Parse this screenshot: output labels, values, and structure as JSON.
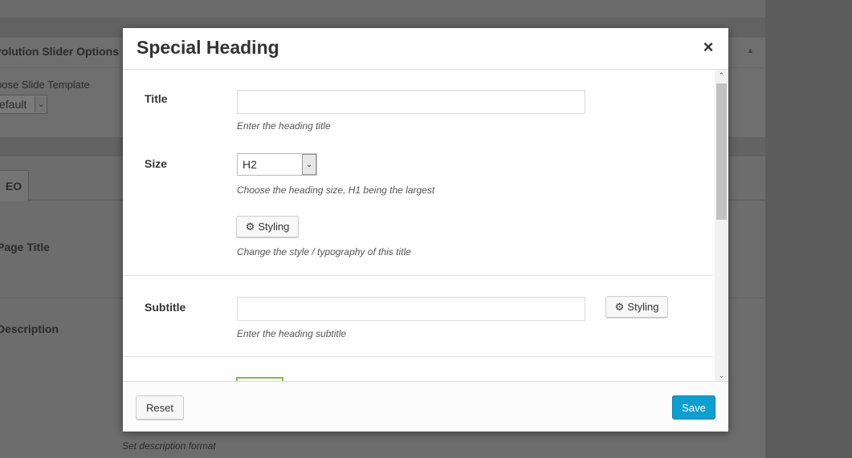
{
  "background": {
    "box_title": "volution Slider Options",
    "template_label": "oose Slide Template",
    "template_value": "efault",
    "tab_label": "EO",
    "field_page_title": "Page Title",
    "field_description": "Description",
    "description_hint": "Set description format"
  },
  "modal": {
    "title": "Special Heading",
    "close_label": "×",
    "fields": {
      "title": {
        "label": "Title",
        "value": "",
        "hint": "Enter the heading title"
      },
      "size": {
        "label": "Size",
        "selected": "H2",
        "hint": "Choose the heading size, H1 being the largest",
        "styling_button": "Styling",
        "styling_hint": "Change the style / typography of this title"
      },
      "subtitle": {
        "label": "Subtitle",
        "value": "",
        "hint": "Enter the heading subtitle",
        "styling_button": "Styling"
      }
    },
    "footer": {
      "reset_label": "Reset",
      "save_label": "Save"
    }
  },
  "colors": {
    "save_button": "#0e9fd0",
    "overlay": "#6b6b6b",
    "green_accent": "#7ac142"
  },
  "icons": {
    "close": "close-icon",
    "gear": "gear-icon",
    "select_arrow": "chevron-down-icon",
    "scroll_up": "chevron-up-icon",
    "scroll_down": "chevron-down-icon"
  }
}
